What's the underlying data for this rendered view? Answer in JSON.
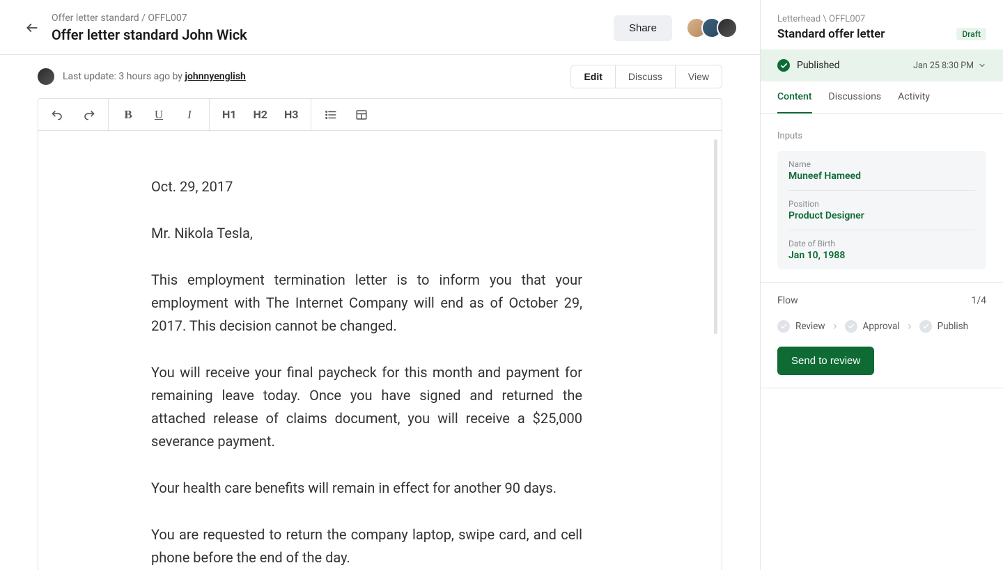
{
  "header": {
    "breadcrumb": "Offer letter standard / OFFL007",
    "title": "Offer letter standard John Wick",
    "share_label": "Share"
  },
  "subheader": {
    "update_prefix": "Last update: 3 hours ago by ",
    "update_user": "johnnyenglish",
    "tabs": {
      "edit": "Edit",
      "discuss": "Discuss",
      "view": "View"
    }
  },
  "toolbar": {
    "h1": "H1",
    "h2": "H2",
    "h3": "H3"
  },
  "document": {
    "date": "Oct. 29, 2017",
    "salutation": "Mr. Nikola Tesla,",
    "p1": "This employment termination letter is to inform you that your employment with The Internet Company will end as of October 29, 2017. This decision cannot be changed.",
    "p2": "You will receive your final paycheck for this month and payment for remaining leave today. Once you have signed and returned the attached release of claims document, you will receive a $25,000 severance payment.",
    "p3": "Your health care benefits will remain in effect for another 90 days.",
    "p4": "You are requested to return the company laptop, swipe card, and cell phone before the end of the day."
  },
  "sidebar": {
    "breadcrumb": "Letterhead \\ OFFL007",
    "title": "Standard offer letter",
    "draft_label": "Draft",
    "status": {
      "text": "Published",
      "timestamp": "Jan 25 8:30 PM"
    },
    "tabs": {
      "content": "Content",
      "discussions": "Discussions",
      "activity": "Activity"
    },
    "inputs_label": "Inputs",
    "inputs": [
      {
        "label": "Name",
        "value": "Muneef Hameed"
      },
      {
        "label": "Position",
        "value": "Product Designer"
      },
      {
        "label": "Date of Birth",
        "value": "Jan 10, 1988"
      }
    ],
    "flow": {
      "label": "Flow",
      "progress": "1/4",
      "steps": [
        "Review",
        "Approval",
        "Publish"
      ],
      "cta": "Send to review"
    }
  }
}
